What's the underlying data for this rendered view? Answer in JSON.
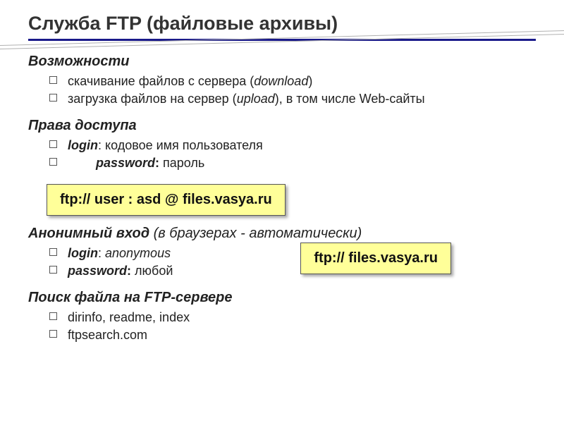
{
  "title": "Служба FTP (файловые архивы)",
  "sections": {
    "capabilities": {
      "heading": "Возможности",
      "items": [
        {
          "text": "скачивание файлов c сервера (",
          "italic": "download",
          "after": ")"
        },
        {
          "text": "загрузка файлов на сервер (",
          "italic": "upload",
          "after": "), в том числе Web-сайты"
        }
      ]
    },
    "access": {
      "heading": "Права доступа",
      "items": [
        {
          "label": "login",
          "sep": ": ",
          "value": "кодовое имя пользователя"
        },
        {
          "label": "password",
          "sep": ": ",
          "value": "пароль",
          "indent": true
        }
      ]
    },
    "url_box1": "ftp:// user : asd @ files.vasya.ru",
    "anon": {
      "heading": "Анонимный вход",
      "heading_paren": " (в браузерах - автоматически)",
      "items": [
        {
          "label": "login",
          "sep": ": ",
          "value_italic": "anonymous"
        },
        {
          "label": "password",
          "sep": ": ",
          "value": "любой"
        }
      ]
    },
    "url_box2": "ftp:// files.vasya.ru",
    "search": {
      "heading": "Поиск файла на FTP-сервере",
      "items": [
        "dirinfo, readme, index",
        "ftpsearch.com"
      ]
    }
  }
}
